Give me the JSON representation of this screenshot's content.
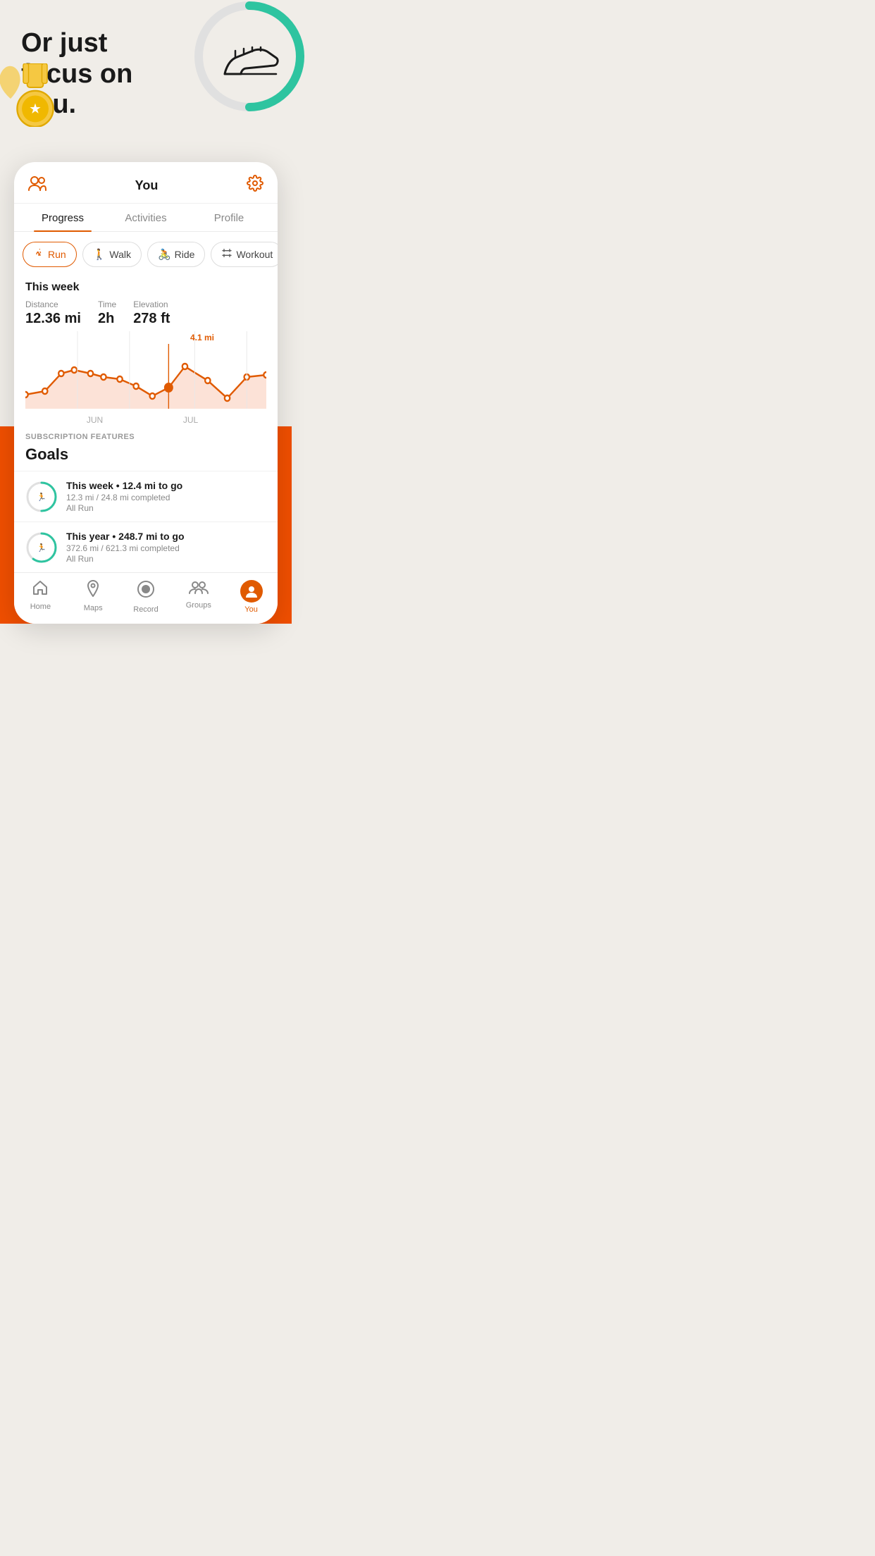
{
  "hero": {
    "title": "Or just focus on you."
  },
  "app": {
    "header_title": "You",
    "tabs": [
      {
        "label": "Progress",
        "active": true
      },
      {
        "label": "Activities",
        "active": false
      },
      {
        "label": "Profile",
        "active": false
      }
    ]
  },
  "activity_chips": [
    {
      "label": "Run",
      "active": true,
      "icon": "🏃"
    },
    {
      "label": "Walk",
      "active": false,
      "icon": "🚶"
    },
    {
      "label": "Ride",
      "active": false,
      "icon": "🚴"
    },
    {
      "label": "Workout",
      "active": false,
      "icon": "🏋️"
    }
  ],
  "stats": {
    "week_label": "This week",
    "distance_label": "Distance",
    "distance_value": "12.36 mi",
    "time_label": "Time",
    "time_value": "2h",
    "elevation_label": "Elevation",
    "elevation_value": "278 ft"
  },
  "chart": {
    "highlighted_value": "4.1 mi",
    "x_labels": [
      "JUN",
      "JUL"
    ]
  },
  "subscription": {
    "section_label": "SUBSCRIPTION FEATURES",
    "goals_title": "Goals",
    "goals": [
      {
        "main": "This week • 12.4 mi to go",
        "sub": "12.3 mi / 24.8 mi completed",
        "type": "All Run",
        "progress": 50
      },
      {
        "main": "This year • 248.7 mi to go",
        "sub": "372.6 mi / 621.3 mi completed",
        "type": "All Run",
        "progress": 60
      }
    ]
  },
  "bottom_nav": [
    {
      "label": "Home",
      "icon": "🏠",
      "active": false
    },
    {
      "label": "Maps",
      "icon": "📍",
      "active": false
    },
    {
      "label": "Record",
      "icon": "⏺",
      "active": false
    },
    {
      "label": "Groups",
      "icon": "👥",
      "active": false
    },
    {
      "label": "You",
      "icon": "👤",
      "active": true
    }
  ],
  "colors": {
    "accent": "#e05a00",
    "bg": "#f0ede8",
    "orange_block": "#f04f00"
  }
}
